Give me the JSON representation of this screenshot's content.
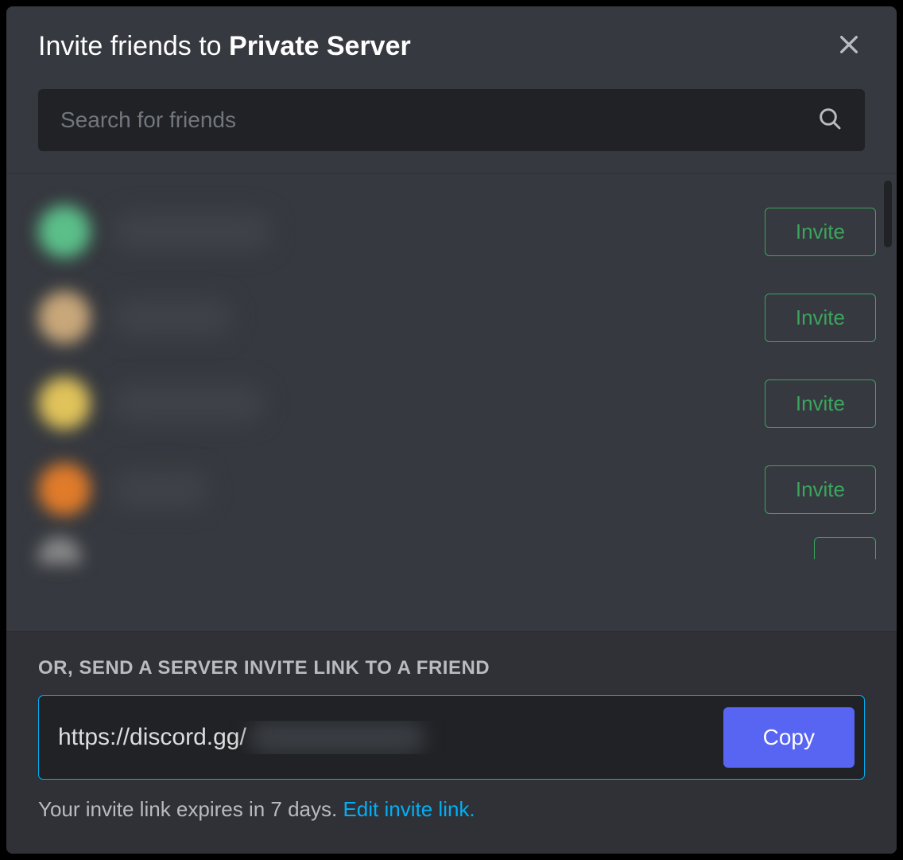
{
  "title_prefix": "Invite friends to ",
  "title_server": "Private Server",
  "search": {
    "placeholder": "Search for friends"
  },
  "invite_button_label": "Invite",
  "friends": [
    {
      "avatar_color": "#5bbf8a",
      "name_width": 200
    },
    {
      "avatar_color": "#c8a77a",
      "name_width": 150
    },
    {
      "avatar_color": "#e0c35a",
      "name_width": 190
    },
    {
      "avatar_color": "#e07b2a",
      "name_width": 120
    }
  ],
  "partial_friend": {
    "avatar_color": "#888888"
  },
  "footer": {
    "label": "OR, SEND A SERVER INVITE LINK TO A FRIEND",
    "link_visible": "https://discord.gg/",
    "copy_label": "Copy",
    "expire_text": "Your invite link expires in 7 days. ",
    "edit_text": "Edit invite link."
  }
}
